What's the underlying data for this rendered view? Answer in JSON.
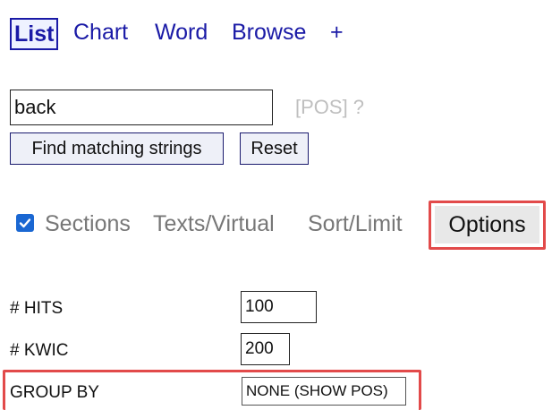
{
  "nav": {
    "items": [
      {
        "label": "List",
        "active": true
      },
      {
        "label": "Chart"
      },
      {
        "label": "Word"
      },
      {
        "label": "Browse"
      },
      {
        "label": "+"
      }
    ]
  },
  "search": {
    "value": "back",
    "pos_label": "[POS] ?",
    "find_label": "Find matching strings",
    "reset_label": "Reset"
  },
  "tabs": {
    "sections_checked": true,
    "sections_label": "Sections",
    "texts_label": "Texts/Virtual",
    "sort_label": "Sort/Limit",
    "options_label": "Options"
  },
  "options": {
    "hits_label": "# HITS",
    "hits_value": "100",
    "kwic_label": "# KWIC",
    "kwic_value": "200",
    "group_label": "GROUP BY",
    "group_value": "NONE (SHOW POS)"
  },
  "colors": {
    "link": "#1a1aa6",
    "highlight": "#e24a4a",
    "checkbox": "#1a67d2"
  }
}
